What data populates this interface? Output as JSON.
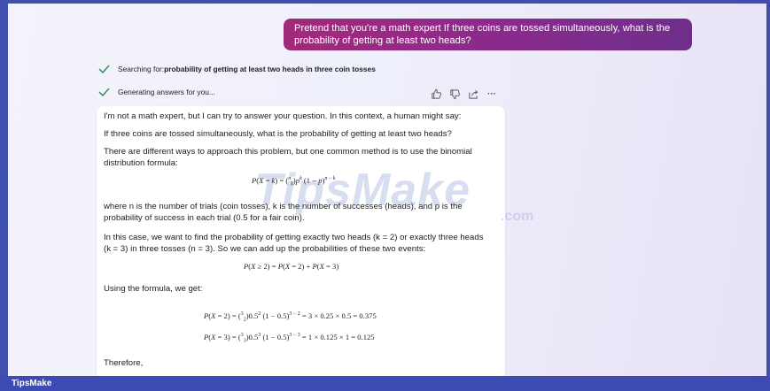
{
  "user_message": "Pretend that you're a math expert If three coins are tossed simultaneously, what is the probability of getting at least two heads?",
  "status": {
    "searching_prefix": "Searching for: ",
    "searching_query": "probability of getting at least two heads in three coin tosses",
    "generating": "Generating answers for you..."
  },
  "actions": {
    "like_icon": "thumbs-up-icon",
    "dislike_icon": "thumbs-down-icon",
    "share_icon": "share-icon",
    "more_label": "···"
  },
  "answer": {
    "p1": "I'm not a math expert, but I can try to answer your question. In this context, a human might say:",
    "p2": "If three coins are tossed simultaneously, what is the probability of getting at least two heads?",
    "p3": "There are different ways to approach this problem, but one common method is to use the binomial distribution formula:",
    "eq1": "P(X = k) = (n k)p^k (1 − p)^(n − k)",
    "p4": "where n is the number of trials (coin tosses), k is the number of successes (heads), and p is the probability of success in each trial (0.5 for a fair coin).",
    "p5": "In this case, we want to find the probability of getting exactly two heads (k = 2) or exactly three heads (k = 3) in three tosses (n = 3). So we can add up the probabilities of these two events:",
    "eq2": "P(X ≥ 2) = P(X = 2) + P(X = 3)",
    "p6": "Using the formula, we get:",
    "eq3": "P(X = 2) = (3 2)0.5^2 (1 − 0.5)^(3 − 2) = 3 × 0.25 × 0.5 = 0.375",
    "eq4": "P(X = 3) = (3 3)0.5^3 (1 − 0.5)^(3 − 3) = 1 × 0.125 × 1 = 0.125",
    "p7": "Therefore,"
  },
  "watermark": "TipsMake",
  "watermark_suffix": ".com",
  "footer": "TipsMake",
  "colors": {
    "accent": "#3e4bb4",
    "user_bubble": "#8e2a8c",
    "check": "#2e8b57"
  }
}
